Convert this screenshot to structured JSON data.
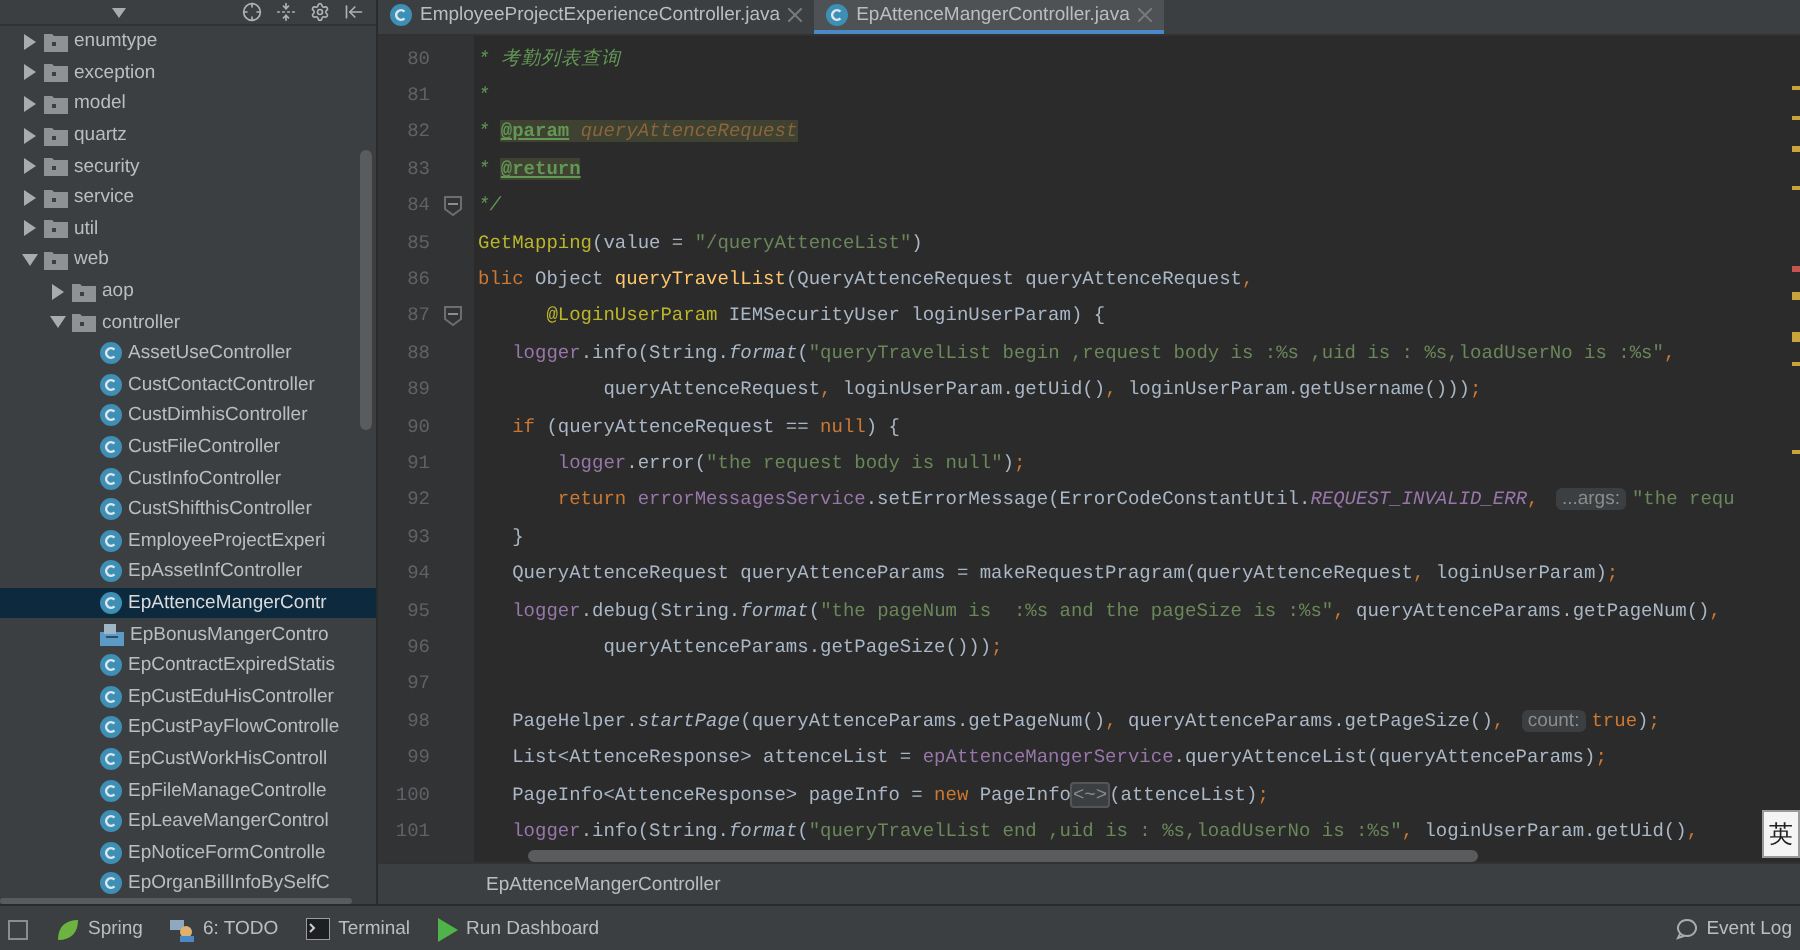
{
  "project_tree": {
    "items": [
      {
        "label": "enumtype",
        "kind": "folder",
        "expanded": false,
        "selected": false
      },
      {
        "label": "exception",
        "kind": "folder",
        "expanded": false,
        "selected": false
      },
      {
        "label": "model",
        "kind": "folder",
        "expanded": false,
        "selected": false
      },
      {
        "label": "quartz",
        "kind": "folder",
        "expanded": false,
        "selected": false
      },
      {
        "label": "security",
        "kind": "folder",
        "expanded": false,
        "selected": false
      },
      {
        "label": "service",
        "kind": "folder",
        "expanded": false,
        "selected": false
      },
      {
        "label": "util",
        "kind": "folder",
        "expanded": false,
        "selected": false
      },
      {
        "label": "web",
        "kind": "folder",
        "expanded": true,
        "selected": false,
        "children": [
          {
            "label": "aop",
            "kind": "folder",
            "expanded": false,
            "selected": false
          },
          {
            "label": "controller",
            "kind": "folder",
            "expanded": true,
            "selected": false,
            "children": [
              {
                "label": "AssetUseController",
                "kind": "class",
                "selected": false
              },
              {
                "label": "CustContactController",
                "kind": "class",
                "selected": false
              },
              {
                "label": "CustDimhisController",
                "kind": "class",
                "selected": false
              },
              {
                "label": "CustFileController",
                "kind": "class",
                "selected": false
              },
              {
                "label": "CustInfoController",
                "kind": "class",
                "selected": false
              },
              {
                "label": "CustShifthisController",
                "kind": "class",
                "selected": false
              },
              {
                "label": "EmployeeProjectExperi",
                "kind": "class",
                "selected": false
              },
              {
                "label": "EpAssetInfController",
                "kind": "class",
                "selected": false
              },
              {
                "label": "EpAttenceMangerContr",
                "kind": "class",
                "selected": true
              },
              {
                "label": "EpBonusMangerContro",
                "kind": "resource",
                "selected": false
              },
              {
                "label": "EpContractExpiredStatis",
                "kind": "class",
                "selected": false
              },
              {
                "label": "EpCustEduHisController",
                "kind": "class",
                "selected": false
              },
              {
                "label": "EpCustPayFlowControlle",
                "kind": "class",
                "selected": false
              },
              {
                "label": "EpCustWorkHisControll",
                "kind": "class",
                "selected": false
              },
              {
                "label": "EpFileManageControlle",
                "kind": "class",
                "selected": false
              },
              {
                "label": "EpLeaveMangerControl",
                "kind": "class",
                "selected": false
              },
              {
                "label": "EpNoticeFormControlle",
                "kind": "class",
                "selected": false
              },
              {
                "label": "EpOrganBillInfoBySelfC",
                "kind": "class",
                "selected": false
              }
            ]
          }
        ]
      }
    ]
  },
  "editor_tabs": [
    {
      "label": "EmployeeProjectExperienceController.java",
      "selected": false
    },
    {
      "label": "EpAttenceMangerController.java",
      "selected": true
    }
  ],
  "code_lines": [
    {
      "number": "80",
      "tokens": [
        {
          "kind": "comment",
          "text": "* 考勤列表查询"
        }
      ]
    },
    {
      "number": "81",
      "tokens": [
        {
          "kind": "comment",
          "text": "*"
        }
      ]
    },
    {
      "number": "82",
      "tokens": [
        {
          "kind": "comment",
          "text": "* "
        },
        {
          "kind": "doctag",
          "text": "@param"
        },
        {
          "kind": "docparam",
          "text": " queryAttenceRequest"
        }
      ]
    },
    {
      "number": "83",
      "tokens": [
        {
          "kind": "comment",
          "text": "* "
        },
        {
          "kind": "doctag",
          "text": "@return"
        }
      ]
    },
    {
      "number": "84",
      "fold": true,
      "tokens": [
        {
          "kind": "comment",
          "text": "*/"
        }
      ]
    },
    {
      "number": "85",
      "tokens": [
        {
          "kind": "annotation",
          "text": "GetMapping"
        },
        {
          "kind": "plain",
          "text": "(value = "
        },
        {
          "kind": "string",
          "text": "\"/queryAttenceList\""
        },
        {
          "kind": "plain",
          "text": ")"
        }
      ]
    },
    {
      "number": "86",
      "tokens": [
        {
          "kind": "keyword",
          "text": "blic"
        },
        {
          "kind": "plain",
          "text": " Object "
        },
        {
          "kind": "method",
          "text": "queryTravelList"
        },
        {
          "kind": "plain",
          "text": "(QueryAttenceRequest queryAttenceRequest"
        },
        {
          "kind": "keyword",
          "text": ","
        }
      ]
    },
    {
      "number": "87",
      "fold": true,
      "tokens": [
        {
          "kind": "annotation",
          "text": "      @LoginUserParam"
        },
        {
          "kind": "plain",
          "text": " IEMSecurityUser loginUserParam) {"
        }
      ]
    },
    {
      "number": "88",
      "tokens": [
        {
          "kind": "field",
          "text": "   logger"
        },
        {
          "kind": "plain",
          "text": ".info(String."
        },
        {
          "kind": "static",
          "text": "format"
        },
        {
          "kind": "plain",
          "text": "("
        },
        {
          "kind": "string",
          "text": "\"queryTravelList begin ,request body is :%s ,uid is : %s,loadUserNo is :%s\""
        },
        {
          "kind": "keyword",
          "text": ","
        }
      ]
    },
    {
      "number": "89",
      "tokens": [
        {
          "kind": "plain",
          "text": "           queryAttenceRequest"
        },
        {
          "kind": "keyword",
          "text": ","
        },
        {
          "kind": "plain",
          "text": " loginUserParam.getUid()"
        },
        {
          "kind": "keyword",
          "text": ","
        },
        {
          "kind": "plain",
          "text": " loginUserParam.getUsername()))"
        },
        {
          "kind": "keyword",
          "text": ";"
        }
      ]
    },
    {
      "number": "90",
      "tokens": [
        {
          "kind": "keyword",
          "text": "   if"
        },
        {
          "kind": "plain",
          "text": " (queryAttenceRequest == "
        },
        {
          "kind": "keyword",
          "text": "null"
        },
        {
          "kind": "plain",
          "text": ") {"
        }
      ]
    },
    {
      "number": "91",
      "tokens": [
        {
          "kind": "field",
          "text": "       logger"
        },
        {
          "kind": "plain",
          "text": ".error("
        },
        {
          "kind": "string",
          "text": "\"the request body is null\""
        },
        {
          "kind": "plain",
          "text": ")"
        },
        {
          "kind": "keyword",
          "text": ";"
        }
      ]
    },
    {
      "number": "92",
      "tokens": [
        {
          "kind": "keyword",
          "text": "       return"
        },
        {
          "kind": "field",
          "text": " errorMessagesService"
        },
        {
          "kind": "plain",
          "text": ".setErrorMessage(ErrorCodeConstantUtil."
        },
        {
          "kind": "constant",
          "text": "REQUEST_INVALID_ERR"
        },
        {
          "kind": "keyword",
          "text": ", "
        },
        {
          "kind": "hint",
          "text": "...args:"
        },
        {
          "kind": "string",
          "text": "\"the requ"
        }
      ]
    },
    {
      "number": "93",
      "tokens": [
        {
          "kind": "plain",
          "text": "   }"
        }
      ]
    },
    {
      "number": "94",
      "tokens": [
        {
          "kind": "plain",
          "text": "   QueryAttenceRequest queryAttenceParams = makeRequestPragram(queryAttenceRequest"
        },
        {
          "kind": "keyword",
          "text": ","
        },
        {
          "kind": "plain",
          "text": " loginUserParam)"
        },
        {
          "kind": "keyword",
          "text": ";"
        }
      ]
    },
    {
      "number": "95",
      "tokens": [
        {
          "kind": "field",
          "text": "   logger"
        },
        {
          "kind": "plain",
          "text": ".debug(String."
        },
        {
          "kind": "static",
          "text": "format"
        },
        {
          "kind": "plain",
          "text": "("
        },
        {
          "kind": "string",
          "text": "\"the pageNum is  :%s and the pageSize is :%s\""
        },
        {
          "kind": "keyword",
          "text": ","
        },
        {
          "kind": "plain",
          "text": " queryAttenceParams.getPageNum()"
        },
        {
          "kind": "keyword",
          "text": ","
        }
      ]
    },
    {
      "number": "96",
      "tokens": [
        {
          "kind": "plain",
          "text": "           queryAttenceParams.getPageSize()))"
        },
        {
          "kind": "keyword",
          "text": ";"
        }
      ]
    },
    {
      "number": "97"
    },
    {
      "number": "98",
      "tokens": [
        {
          "kind": "plain",
          "text": "   PageHelper."
        },
        {
          "kind": "static",
          "text": "startPage"
        },
        {
          "kind": "plain",
          "text": "(queryAttenceParams.getPageNum()"
        },
        {
          "kind": "keyword",
          "text": ","
        },
        {
          "kind": "plain",
          "text": " queryAttenceParams.getPageSize()"
        },
        {
          "kind": "keyword",
          "text": ", "
        },
        {
          "kind": "hint",
          "text": "count:"
        },
        {
          "kind": "keyword",
          "text": "true"
        },
        {
          "kind": "plain",
          "text": ")"
        },
        {
          "kind": "keyword",
          "text": ";"
        }
      ]
    },
    {
      "number": "99",
      "tokens": [
        {
          "kind": "plain",
          "text": "   List<AttenceResponse> attenceList = "
        },
        {
          "kind": "field",
          "text": "epAttenceMangerService"
        },
        {
          "kind": "plain",
          "text": ".queryAttenceList(queryAttenceParams)"
        },
        {
          "kind": "keyword",
          "text": ";"
        }
      ]
    },
    {
      "number": "100",
      "tokens": [
        {
          "kind": "plain",
          "text": "   PageInfo<AttenceResponse> pageInfo = "
        },
        {
          "kind": "keyword",
          "text": "new"
        },
        {
          "kind": "plain",
          "text": " PageInfo"
        },
        {
          "kind": "fold",
          "text": "<~>"
        },
        {
          "kind": "plain",
          "text": "(attenceList)"
        },
        {
          "kind": "keyword",
          "text": ";"
        }
      ]
    },
    {
      "number": "101",
      "tokens": [
        {
          "kind": "field",
          "text": "   logger"
        },
        {
          "kind": "plain",
          "text": ".info(String."
        },
        {
          "kind": "static",
          "text": "format"
        },
        {
          "kind": "plain",
          "text": "("
        },
        {
          "kind": "string",
          "text": "\"queryTravelList end ,uid is : %s,loadUserNo is :%s\""
        },
        {
          "kind": "keyword",
          "text": ","
        },
        {
          "kind": "plain",
          "text": " loginUserParam.getUid()"
        },
        {
          "kind": "keyword",
          "text": ","
        }
      ]
    }
  ],
  "ime_indicator": "英",
  "breadcrumb": "EpAttenceMangerController",
  "status_bar": {
    "items": [
      {
        "label": "Spring",
        "kind": "spring"
      },
      {
        "label": "6: TODO",
        "kind": "todo"
      },
      {
        "label": "Terminal",
        "kind": "terminal"
      },
      {
        "label": "Run Dashboard",
        "kind": "run"
      }
    ],
    "event_log": "Event Log"
  }
}
